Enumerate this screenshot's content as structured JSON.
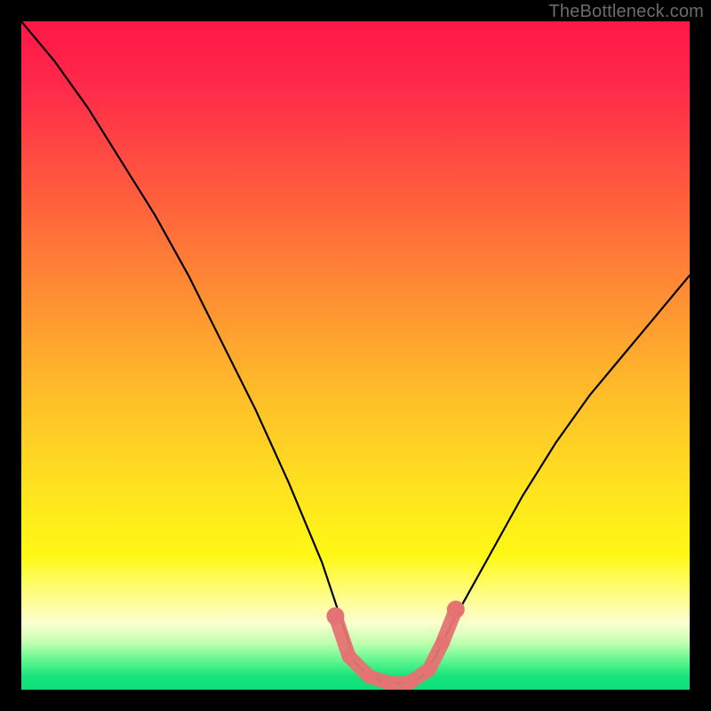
{
  "watermark": "TheBottleneck.com",
  "chart_data": {
    "type": "line",
    "title": "",
    "xlabel": "",
    "ylabel": "",
    "xlim": [
      0,
      100
    ],
    "ylim": [
      0,
      100
    ],
    "grid": false,
    "legend": false,
    "series": [
      {
        "name": "curve",
        "color": "#000000",
        "x": [
          0,
          5,
          10,
          15,
          20,
          25,
          30,
          35,
          40,
          45,
          48,
          50,
          52,
          55,
          58,
          60,
          62,
          65,
          70,
          75,
          80,
          85,
          90,
          95,
          100
        ],
        "values": [
          100,
          94,
          87,
          79,
          71,
          62,
          52,
          42,
          31,
          19,
          10,
          4,
          2,
          1,
          1,
          2,
          5,
          11,
          20,
          29,
          37,
          44,
          50,
          56,
          62
        ]
      }
    ],
    "markers": {
      "name": "highlight-points",
      "color": "#e57373",
      "radius_px": 8,
      "caps_radius_px": 10,
      "x": [
        47,
        49,
        52,
        55,
        58,
        61,
        63,
        65
      ],
      "values": [
        11,
        5,
        2,
        1,
        1,
        3,
        7,
        12
      ]
    }
  }
}
